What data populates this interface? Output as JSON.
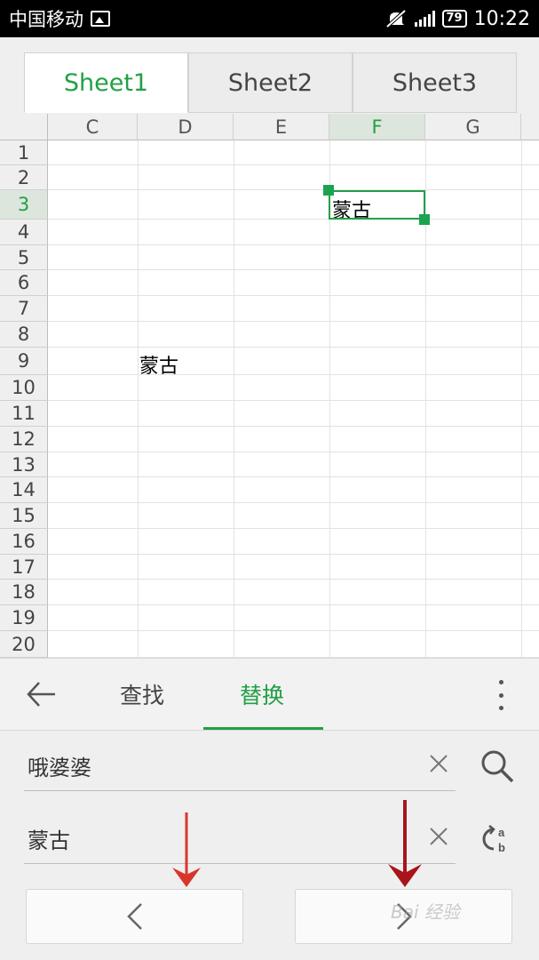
{
  "status_bar": {
    "carrier": "中国移动",
    "battery": "79",
    "time": "10:22"
  },
  "sheets": [
    {
      "label": "Sheet1",
      "active": true
    },
    {
      "label": "Sheet2",
      "active": false
    },
    {
      "label": "Sheet3",
      "active": false
    }
  ],
  "grid": {
    "columns": [
      "C",
      "D",
      "E",
      "F",
      "G"
    ],
    "selected_column": "F",
    "rows": [
      "1",
      "2",
      "3",
      "4",
      "5",
      "6",
      "7",
      "8",
      "9",
      "10",
      "11",
      "12",
      "13",
      "14",
      "15",
      "16",
      "17",
      "18",
      "19",
      "20"
    ],
    "selected_row": "3",
    "cells": [
      {
        "ref": "F3",
        "value": "蒙古"
      },
      {
        "ref": "D9",
        "value": "蒙古"
      }
    ]
  },
  "find_replace": {
    "tabs": [
      {
        "label": "查找",
        "active": false
      },
      {
        "label": "替换",
        "active": true
      }
    ],
    "find_value": "哦婆婆",
    "replace_value": "蒙古"
  },
  "watermark": "Bai 经验",
  "colors": {
    "accent": "#22a045",
    "annotation_red": "#d9362b"
  }
}
